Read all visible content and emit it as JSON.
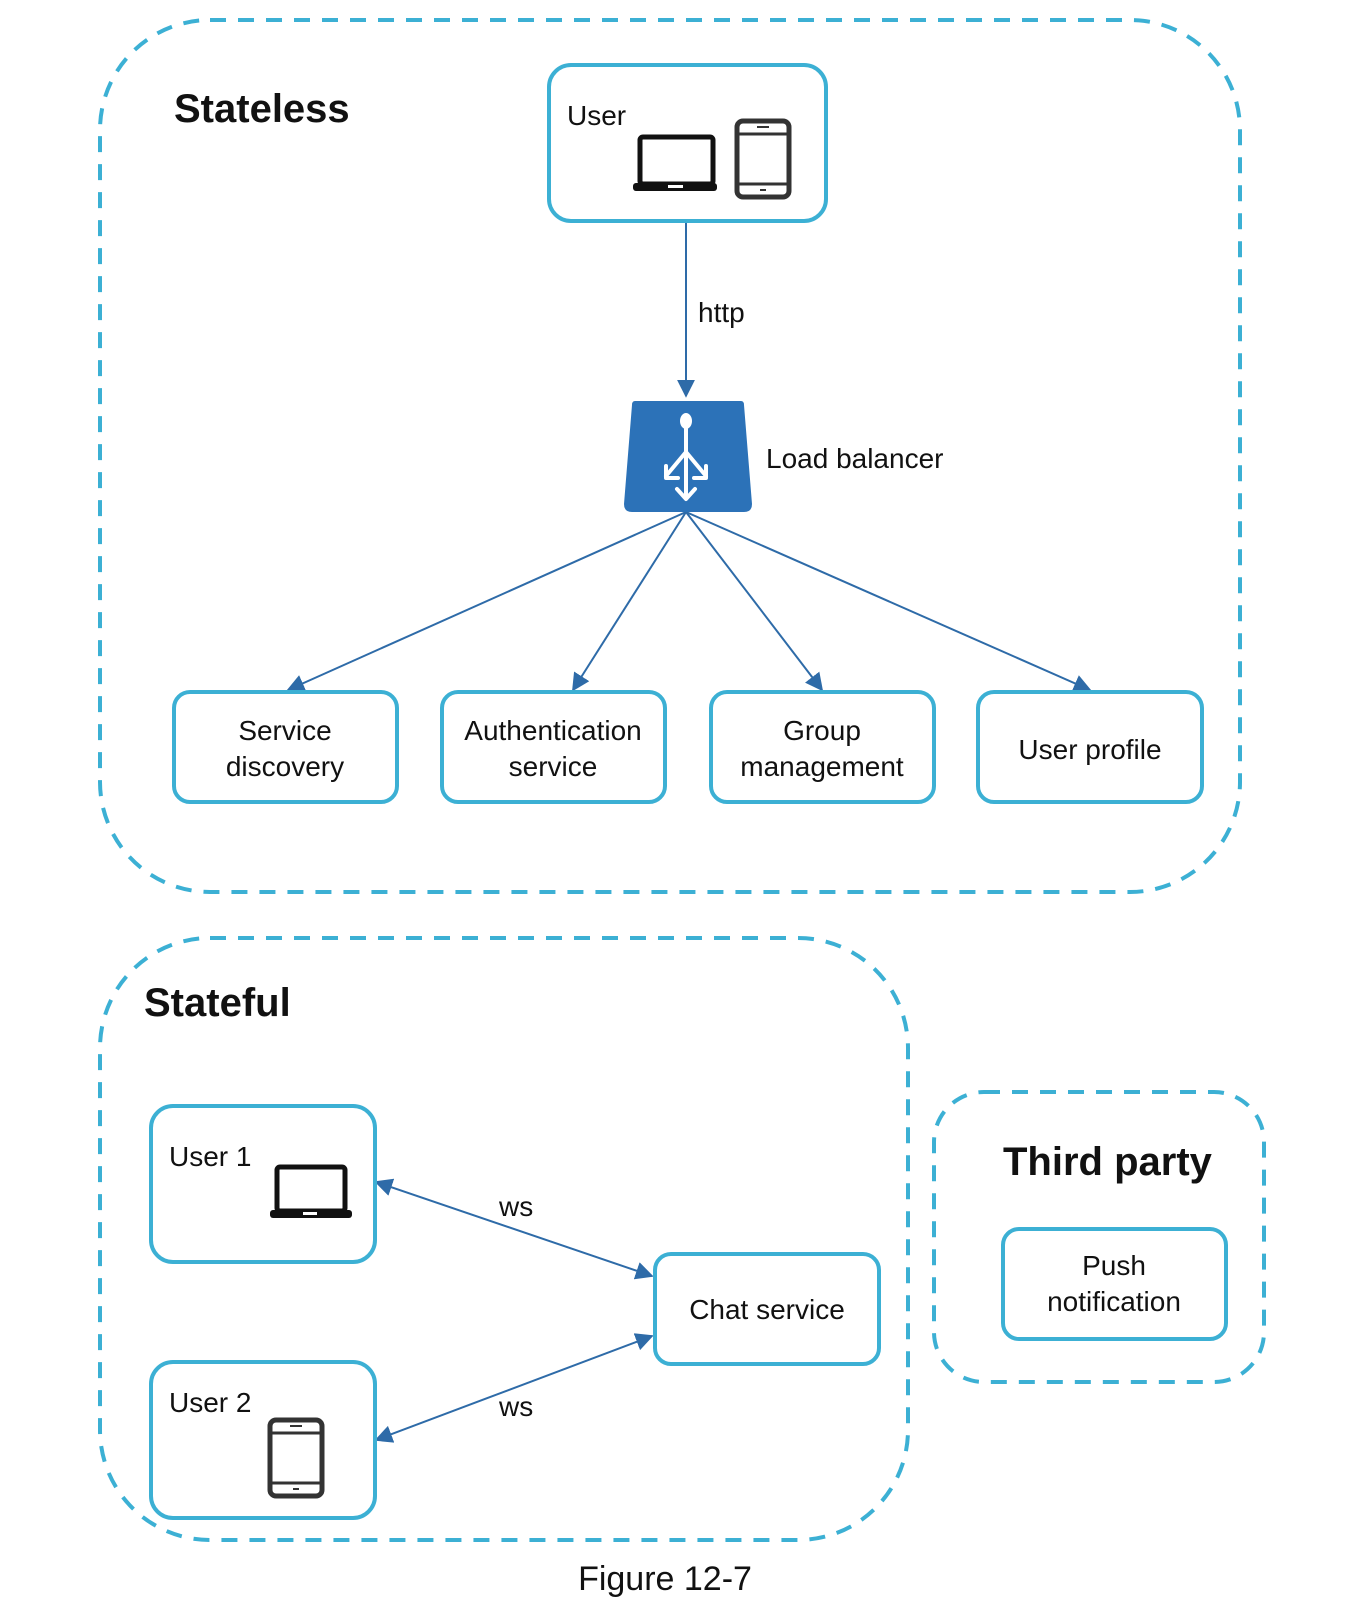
{
  "colors": {
    "group_border": "#3cb0d4",
    "box_border": "#3cb0d4",
    "arrow": "#2e6ba8",
    "load_balancer": "#2c72b8",
    "text": "#111111"
  },
  "groups": {
    "stateless": {
      "title": "Stateless"
    },
    "stateful": {
      "title": "Stateful"
    },
    "third_party": {
      "title": "Third party"
    }
  },
  "nodes": {
    "user": {
      "label": "User",
      "icons": [
        "laptop-icon",
        "tablet-icon"
      ]
    },
    "load_balancer": {
      "label": "Load balancer",
      "icon": "load-balancer-icon"
    },
    "service_discovery": {
      "line1": "Service",
      "line2": "discovery"
    },
    "authentication_service": {
      "line1": "Authentication",
      "line2": "service"
    },
    "group_management": {
      "line1": "Group",
      "line2": "management"
    },
    "user_profile": {
      "label": "User profile"
    },
    "user1": {
      "label": "User 1",
      "icon": "laptop-icon"
    },
    "user2": {
      "label": "User 2",
      "icon": "tablet-icon"
    },
    "chat_service": {
      "label": "Chat service"
    },
    "push_notification": {
      "line1": "Push",
      "line2": "notification"
    }
  },
  "edges": {
    "user_to_lb": {
      "label": "http"
    },
    "user1_chat": {
      "label": "ws"
    },
    "user2_chat": {
      "label": "ws"
    }
  },
  "caption": "Figure 12-7"
}
